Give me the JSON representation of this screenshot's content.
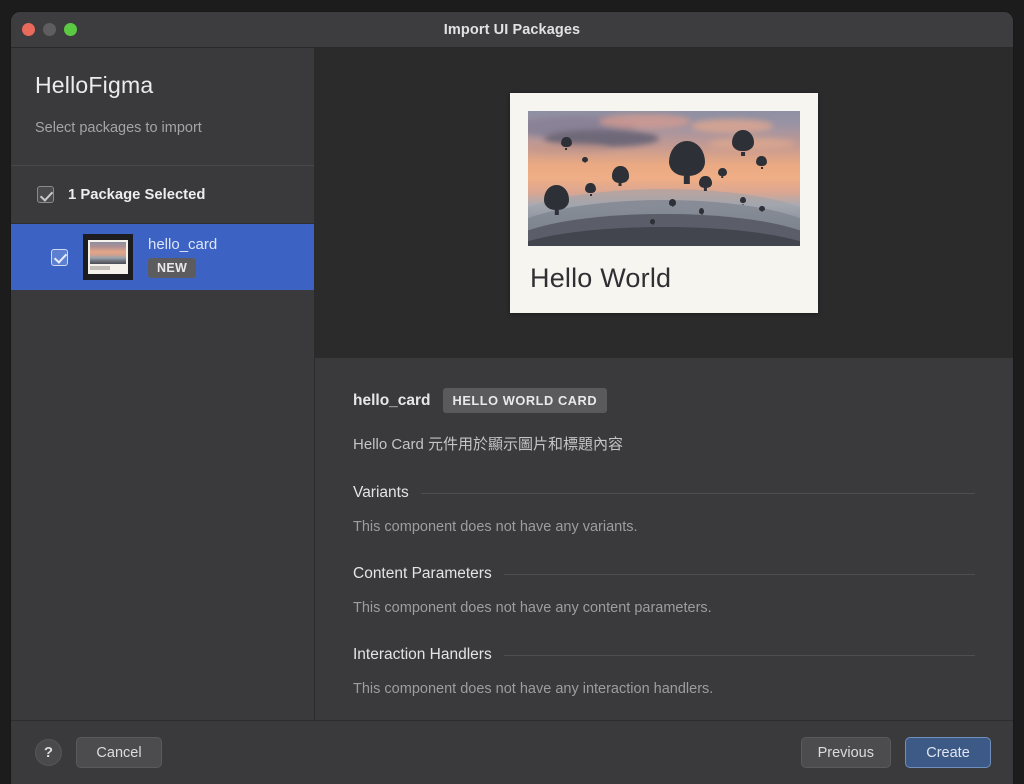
{
  "window": {
    "title": "Import UI Packages",
    "traffic_lights": [
      "close",
      "minimize",
      "zoom"
    ]
  },
  "sidebar": {
    "app_title": "HelloFigma",
    "subtitle": "Select packages to import",
    "select_all": {
      "label": "1 Package Selected",
      "checked": true
    },
    "packages": [
      {
        "name": "hello_card",
        "badge": "NEW",
        "checked": true,
        "selected": true
      }
    ]
  },
  "preview": {
    "card": {
      "title": "Hello World",
      "image_alt": "hot-air-balloons-at-sunset"
    }
  },
  "detail": {
    "component_name": "hello_card",
    "type_badge": "HELLO WORLD CARD",
    "description": "Hello Card 元件用於顯示圖片和標題內容",
    "sections": [
      {
        "title": "Variants",
        "body": "This component does not have any variants."
      },
      {
        "title": "Content Parameters",
        "body": "This component does not have any content parameters."
      },
      {
        "title": "Interaction Handlers",
        "body": "This component does not have any interaction handlers."
      }
    ]
  },
  "footer": {
    "help_label": "?",
    "cancel_label": "Cancel",
    "previous_label": "Previous",
    "create_label": "Create"
  },
  "colors": {
    "window_bg": "#3a3a3c",
    "preview_bg": "#2b2b2c",
    "selection_blue": "#3c63c4",
    "primary_button": "#3d5a86",
    "card_paper": "#f7f5f0"
  }
}
